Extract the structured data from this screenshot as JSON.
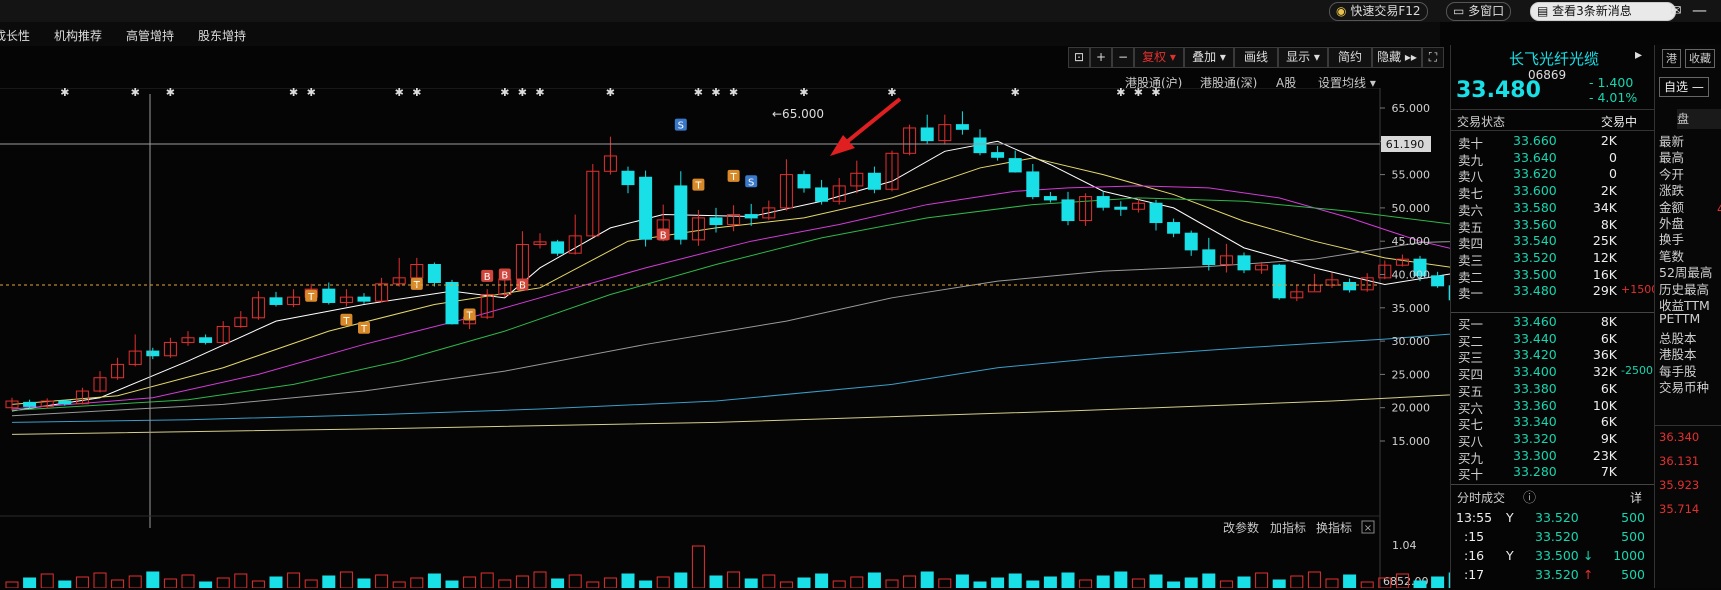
{
  "topbar": {
    "quick_trade": "快速交易F12",
    "multi_window": "多窗口",
    "messages": "查看3条新消息"
  },
  "tabs": [
    "成长性",
    "机构推荐",
    "高管增持",
    "股东增持"
  ],
  "toolbar": {
    "buttons": [
      "复权 ▾",
      "叠加 ▾",
      "画线",
      "显示 ▾",
      "简约",
      "隐藏 ▸▸"
    ],
    "sublinks": [
      "港股通(沪)",
      "港股通(深)",
      "A股",
      "设置均线 ▾"
    ]
  },
  "chart": {
    "max_annotation": "←65.000",
    "crosshair_label": "61.190",
    "y_ticks": [
      "65.000",
      "60.000",
      "55.000",
      "50.000",
      "45.000",
      "40.000",
      "35.000",
      "30.000",
      "25.000",
      "20.000",
      "15.000"
    ],
    "indicator_links": [
      "改参数",
      "加指标",
      "换指标"
    ],
    "vol_ticks": [
      "1.04",
      "6852.00"
    ]
  },
  "quote": {
    "name": "长飞光纤光缆",
    "code": "06869",
    "price": "33.480",
    "change": "- 1.400",
    "change_pct": "- 4.01%",
    "hk_btn": "港",
    "fav_btn": "收藏",
    "add_self_btn": "自选 —",
    "panel_label": "盘",
    "status_label": "交易状态",
    "status_value": "交易中"
  },
  "order_book": {
    "asks": [
      {
        "label": "卖十",
        "price": "33.660",
        "qty": "2K",
        "chg": ""
      },
      {
        "label": "卖九",
        "price": "33.640",
        "qty": "0",
        "chg": ""
      },
      {
        "label": "卖八",
        "price": "33.620",
        "qty": "0",
        "chg": ""
      },
      {
        "label": "卖七",
        "price": "33.600",
        "qty": "2K",
        "chg": ""
      },
      {
        "label": "卖六",
        "price": "33.580",
        "qty": "34K",
        "chg": ""
      },
      {
        "label": "卖五",
        "price": "33.560",
        "qty": "8K",
        "chg": ""
      },
      {
        "label": "卖四",
        "price": "33.540",
        "qty": "25K",
        "chg": ""
      },
      {
        "label": "卖三",
        "price": "33.520",
        "qty": "12K",
        "chg": ""
      },
      {
        "label": "卖二",
        "price": "33.500",
        "qty": "16K",
        "chg": ""
      },
      {
        "label": "卖一",
        "price": "33.480",
        "qty": "29K",
        "chg": "+1500"
      }
    ],
    "bids": [
      {
        "label": "买一",
        "price": "33.460",
        "qty": "8K",
        "chg": ""
      },
      {
        "label": "买二",
        "price": "33.440",
        "qty": "6K",
        "chg": ""
      },
      {
        "label": "买三",
        "price": "33.420",
        "qty": "36K",
        "chg": ""
      },
      {
        "label": "买四",
        "price": "33.400",
        "qty": "32K",
        "chg": "-2500"
      },
      {
        "label": "买五",
        "price": "33.380",
        "qty": "6K",
        "chg": ""
      },
      {
        "label": "买六",
        "price": "33.360",
        "qty": "10K",
        "chg": ""
      },
      {
        "label": "买七",
        "price": "33.340",
        "qty": "6K",
        "chg": ""
      },
      {
        "label": "买八",
        "price": "33.320",
        "qty": "9K",
        "chg": ""
      },
      {
        "label": "买九",
        "price": "33.300",
        "qty": "23K",
        "chg": ""
      },
      {
        "label": "买十",
        "price": "33.280",
        "qty": "7K",
        "chg": ""
      }
    ]
  },
  "ticks": {
    "title": "分时成交",
    "detail_btn": "详",
    "rows": [
      {
        "time": "13:55",
        "flag": "Y",
        "price": "33.520",
        "vol": "500",
        "arrow": ""
      },
      {
        "time": ":15",
        "flag": "",
        "price": "33.520",
        "vol": "500",
        "arrow": ""
      },
      {
        "time": ":16",
        "flag": "Y",
        "price": "33.500",
        "vol": "1000",
        "arrow": "↓"
      },
      {
        "time": ":17",
        "flag": "",
        "price": "33.520",
        "vol": "500",
        "arrow": "↑"
      }
    ]
  },
  "stats_labels": [
    "最新",
    "最高",
    "今开",
    "涨跌",
    "金额",
    "外盘",
    "换手",
    "笔数",
    "52周最高",
    "历史最高",
    "收益TTM",
    "PETTM",
    "总股本",
    "港股本",
    "每手股",
    "交易币种"
  ],
  "stats_partial_value": "4",
  "price_scale_right": [
    "36.340",
    "36.131",
    "35.923",
    "35.714"
  ],
  "colors": {
    "up": "#e2302f",
    "down": "#19e0e6",
    "ask_price": "#16d6b0",
    "ma5": "#ffffff",
    "ma10": "#e5d86a",
    "ma20": "#d23bd8",
    "ma30": "#2fb84a",
    "ma60": "#9a9a9a",
    "ma120": "#3a9ec9",
    "ma250": "#d6cf8c"
  },
  "chart_data": {
    "type": "candlestick",
    "y_range": [
      12,
      68
    ],
    "candles": [
      [
        20,
        21,
        19.6,
        21.5
      ],
      [
        20.8,
        20.2,
        19.8,
        21.2
      ],
      [
        20.2,
        21,
        19.9,
        21.4
      ],
      [
        21,
        20.6,
        20.3,
        21.2
      ],
      [
        20.6,
        22.5,
        20.5,
        23
      ],
      [
        22.5,
        24.5,
        22.3,
        25.5
      ],
      [
        24.5,
        26.5,
        24.2,
        27.5
      ],
      [
        26.5,
        28.5,
        26.2,
        31
      ],
      [
        28.5,
        27.8,
        27.3,
        29
      ],
      [
        27.8,
        29.8,
        27.5,
        30.5
      ],
      [
        29.8,
        30.5,
        29.3,
        31.5
      ],
      [
        30.5,
        29.8,
        29.5,
        31
      ],
      [
        29.8,
        32.2,
        29.6,
        33
      ],
      [
        32.2,
        33.5,
        32,
        34.5
      ],
      [
        33.5,
        36.5,
        33.2,
        37.5
      ],
      [
        36.5,
        35.5,
        35.2,
        37.4
      ],
      [
        35.5,
        36.6,
        35.1,
        37.8
      ],
      [
        36.6,
        37.8,
        36.3,
        38.6
      ],
      [
        37.8,
        35.8,
        35.5,
        38.8
      ],
      [
        35.8,
        36.6,
        35.2,
        37.8
      ],
      [
        36.6,
        36,
        35.6,
        37.2
      ],
      [
        36,
        38.6,
        35.8,
        39.5
      ],
      [
        38.6,
        39.5,
        38.2,
        42.5
      ],
      [
        39.5,
        41.5,
        39.2,
        42.5
      ],
      [
        41.5,
        38.8,
        38.2,
        41.8
      ],
      [
        38.8,
        32.6,
        32.5,
        39.2
      ],
      [
        32.6,
        33.6,
        31.8,
        34.8
      ],
      [
        33.6,
        37,
        33.3,
        37.8
      ],
      [
        37,
        39.3,
        36.6,
        39.8
      ],
      [
        39.3,
        44.5,
        39.2,
        46.5
      ],
      [
        44.5,
        44.9,
        43.9,
        46.2
      ],
      [
        44.9,
        43.2,
        42.8,
        45.2
      ],
      [
        43.2,
        45.8,
        43,
        49
      ],
      [
        45.8,
        55.5,
        45.6,
        56.6
      ],
      [
        55.5,
        57.8,
        55,
        60.7
      ],
      [
        55.5,
        53.5,
        52.2,
        56.2
      ],
      [
        54.6,
        45.3,
        44.2,
        55.6
      ],
      [
        45.3,
        48.2,
        45,
        50.5
      ],
      [
        53.3,
        45.3,
        44.5,
        55.5
      ],
      [
        45.2,
        48.5,
        44.3,
        49.7
      ],
      [
        48.5,
        47.5,
        46.3,
        50
      ],
      [
        47.5,
        49,
        46.5,
        50.4
      ],
      [
        49,
        48.5,
        47.3,
        50.6
      ],
      [
        48.5,
        50,
        48.2,
        51.1
      ],
      [
        50,
        55,
        49.6,
        57.3
      ],
      [
        55,
        53,
        52.3,
        55.6
      ],
      [
        53,
        51,
        50.5,
        54.2
      ],
      [
        51,
        53.3,
        50.5,
        54.5
      ],
      [
        53.3,
        55.2,
        52.2,
        57.1
      ],
      [
        55.2,
        52.8,
        52.2,
        56.2
      ],
      [
        52.8,
        58.2,
        52.5,
        58.6
      ],
      [
        58.2,
        62,
        57.9,
        62.5
      ],
      [
        62,
        60.1,
        59.6,
        64
      ],
      [
        60.1,
        62.5,
        59.5,
        64
      ],
      [
        62.5,
        61.8,
        61,
        64.5
      ],
      [
        60.5,
        58.3,
        57.9,
        61.8
      ],
      [
        58.3,
        57.6,
        57.1,
        59.3
      ],
      [
        57.4,
        55.4,
        55.3,
        58.6
      ],
      [
        55.4,
        51.7,
        51.3,
        56.6
      ],
      [
        51.7,
        51.2,
        50.8,
        52.4
      ],
      [
        51.2,
        48.1,
        47.4,
        52.4
      ],
      [
        48.1,
        51.7,
        47.3,
        52.2
      ],
      [
        51.7,
        50.1,
        49.6,
        52.5
      ],
      [
        50.1,
        49.8,
        48.8,
        51
      ],
      [
        49.8,
        50.7,
        49.3,
        51.3
      ],
      [
        50.7,
        47.8,
        46.6,
        51.2
      ],
      [
        47.8,
        46.2,
        45.6,
        48.4
      ],
      [
        46.2,
        43.7,
        42.8,
        46.6
      ],
      [
        43.7,
        41.5,
        40.6,
        45.5
      ],
      [
        41.5,
        42.8,
        40.3,
        44.6
      ],
      [
        42.8,
        40.7,
        40.2,
        43.3
      ],
      [
        40.7,
        41.4,
        40.1,
        41.9
      ],
      [
        41.4,
        36.5,
        36.2,
        41.6
      ],
      [
        36.5,
        37.4,
        36,
        38.4
      ],
      [
        37.4,
        38.4,
        37.5,
        40.1
      ],
      [
        38.4,
        39.2,
        38,
        40.3
      ],
      [
        38.8,
        37.7,
        37.3,
        39.4
      ],
      [
        37.7,
        39.5,
        37.4,
        40.2
      ],
      [
        39.5,
        41.4,
        39.3,
        42.1
      ],
      [
        41.4,
        42.3,
        41.2,
        43
      ],
      [
        42.3,
        39.8,
        39,
        42.8
      ],
      [
        39.8,
        38.3,
        38,
        40.4
      ],
      [
        38.3,
        36.2,
        35.5,
        38.6
      ],
      [
        36.2,
        36.4,
        35.7,
        36.7
      ],
      [
        36.4,
        35.2,
        34.7,
        36.8
      ],
      [
        35.2,
        33.5,
        33.3,
        35.4
      ]
    ],
    "ma_lines": {
      "ma5": [
        [
          0,
          19.5
        ],
        [
          5,
          21.5
        ],
        [
          10,
          27
        ],
        [
          15,
          33
        ],
        [
          20,
          35.5
        ],
        [
          25,
          37.5
        ],
        [
          28,
          36.5
        ],
        [
          30,
          41
        ],
        [
          34,
          47
        ],
        [
          37,
          49
        ],
        [
          42,
          48.7
        ],
        [
          46,
          51
        ],
        [
          50,
          54
        ],
        [
          53,
          58.5
        ],
        [
          56,
          60
        ],
        [
          59,
          56.5
        ],
        [
          62,
          52.5
        ],
        [
          66,
          50
        ],
        [
          70,
          44
        ],
        [
          74,
          41
        ],
        [
          78,
          38.5
        ],
        [
          82,
          40.2
        ],
        [
          86,
          36.5
        ],
        [
          88,
          34.5
        ]
      ],
      "ma10": [
        [
          0,
          20.5
        ],
        [
          6,
          21.8
        ],
        [
          12,
          26
        ],
        [
          18,
          31.5
        ],
        [
          24,
          35.5
        ],
        [
          30,
          38
        ],
        [
          35,
          45
        ],
        [
          40,
          47
        ],
        [
          45,
          48.5
        ],
        [
          50,
          51.5
        ],
        [
          55,
          56
        ],
        [
          58,
          57.5
        ],
        [
          62,
          55
        ],
        [
          66,
          52
        ],
        [
          70,
          48
        ],
        [
          74,
          45
        ],
        [
          78,
          42.5
        ],
        [
          82,
          41
        ],
        [
          86,
          39
        ],
        [
          88,
          38
        ]
      ],
      "ma20": [
        [
          0,
          19.8
        ],
        [
          8,
          21.5
        ],
        [
          14,
          25
        ],
        [
          20,
          29.5
        ],
        [
          26,
          33.5
        ],
        [
          32,
          38
        ],
        [
          36,
          41
        ],
        [
          42,
          45
        ],
        [
          47,
          47.5
        ],
        [
          52,
          50.5
        ],
        [
          57,
          52.5
        ],
        [
          60,
          53
        ],
        [
          64,
          53.3
        ],
        [
          68,
          53
        ],
        [
          72,
          51.5
        ],
        [
          76,
          48.5
        ],
        [
          80,
          45
        ],
        [
          84,
          42.5
        ],
        [
          88,
          40.5
        ]
      ],
      "ma30": [
        [
          0,
          19.6
        ],
        [
          10,
          21.2
        ],
        [
          16,
          23.5
        ],
        [
          22,
          27
        ],
        [
          28,
          31.5
        ],
        [
          34,
          37
        ],
        [
          40,
          41.5
        ],
        [
          46,
          45.5
        ],
        [
          52,
          48.5
        ],
        [
          58,
          50.5
        ],
        [
          64,
          51.5
        ],
        [
          70,
          51
        ],
        [
          76,
          49.5
        ],
        [
          82,
          47.5
        ],
        [
          86,
          46
        ],
        [
          88,
          45
        ]
      ],
      "ma60": [
        [
          0,
          18.8
        ],
        [
          12,
          20.5
        ],
        [
          20,
          22.5
        ],
        [
          28,
          25.5
        ],
        [
          36,
          29.5
        ],
        [
          44,
          33
        ],
        [
          50,
          36.5
        ],
        [
          56,
          39
        ],
        [
          62,
          40.5
        ],
        [
          68,
          41.2
        ],
        [
          74,
          42.3
        ],
        [
          80,
          44.8
        ],
        [
          86,
          45.3
        ],
        [
          88,
          45.2
        ]
      ],
      "ma120": [
        [
          0,
          17.8
        ],
        [
          10,
          18.2
        ],
        [
          20,
          18.9
        ],
        [
          30,
          19.8
        ],
        [
          40,
          21
        ],
        [
          50,
          23.5
        ],
        [
          56,
          26
        ],
        [
          62,
          27.5
        ],
        [
          70,
          29
        ],
        [
          78,
          30.3
        ],
        [
          84,
          31.5
        ],
        [
          88,
          32.3
        ]
      ],
      "ma250": [
        [
          0,
          16
        ],
        [
          20,
          16.8
        ],
        [
          40,
          17.8
        ],
        [
          60,
          19.5
        ],
        [
          75,
          21
        ],
        [
          88,
          22.8
        ]
      ]
    },
    "markers": {
      "S": [
        [
          38,
          62.5
        ],
        [
          42,
          54
        ]
      ],
      "T": [
        [
          17,
          36.8
        ],
        [
          19,
          33.2
        ],
        [
          20,
          32
        ],
        [
          23,
          38.6
        ],
        [
          26,
          34
        ],
        [
          39,
          53.5
        ],
        [
          41,
          54.8
        ]
      ],
      "B": [
        [
          27,
          39.8
        ],
        [
          28,
          40
        ],
        [
          29,
          38.5
        ],
        [
          37,
          46
        ]
      ]
    },
    "stars_x": [
      3,
      7,
      9,
      16,
      17,
      22,
      23,
      28,
      29,
      30,
      34,
      39,
      40,
      41,
      45,
      50,
      57,
      63,
      64,
      65
    ]
  }
}
